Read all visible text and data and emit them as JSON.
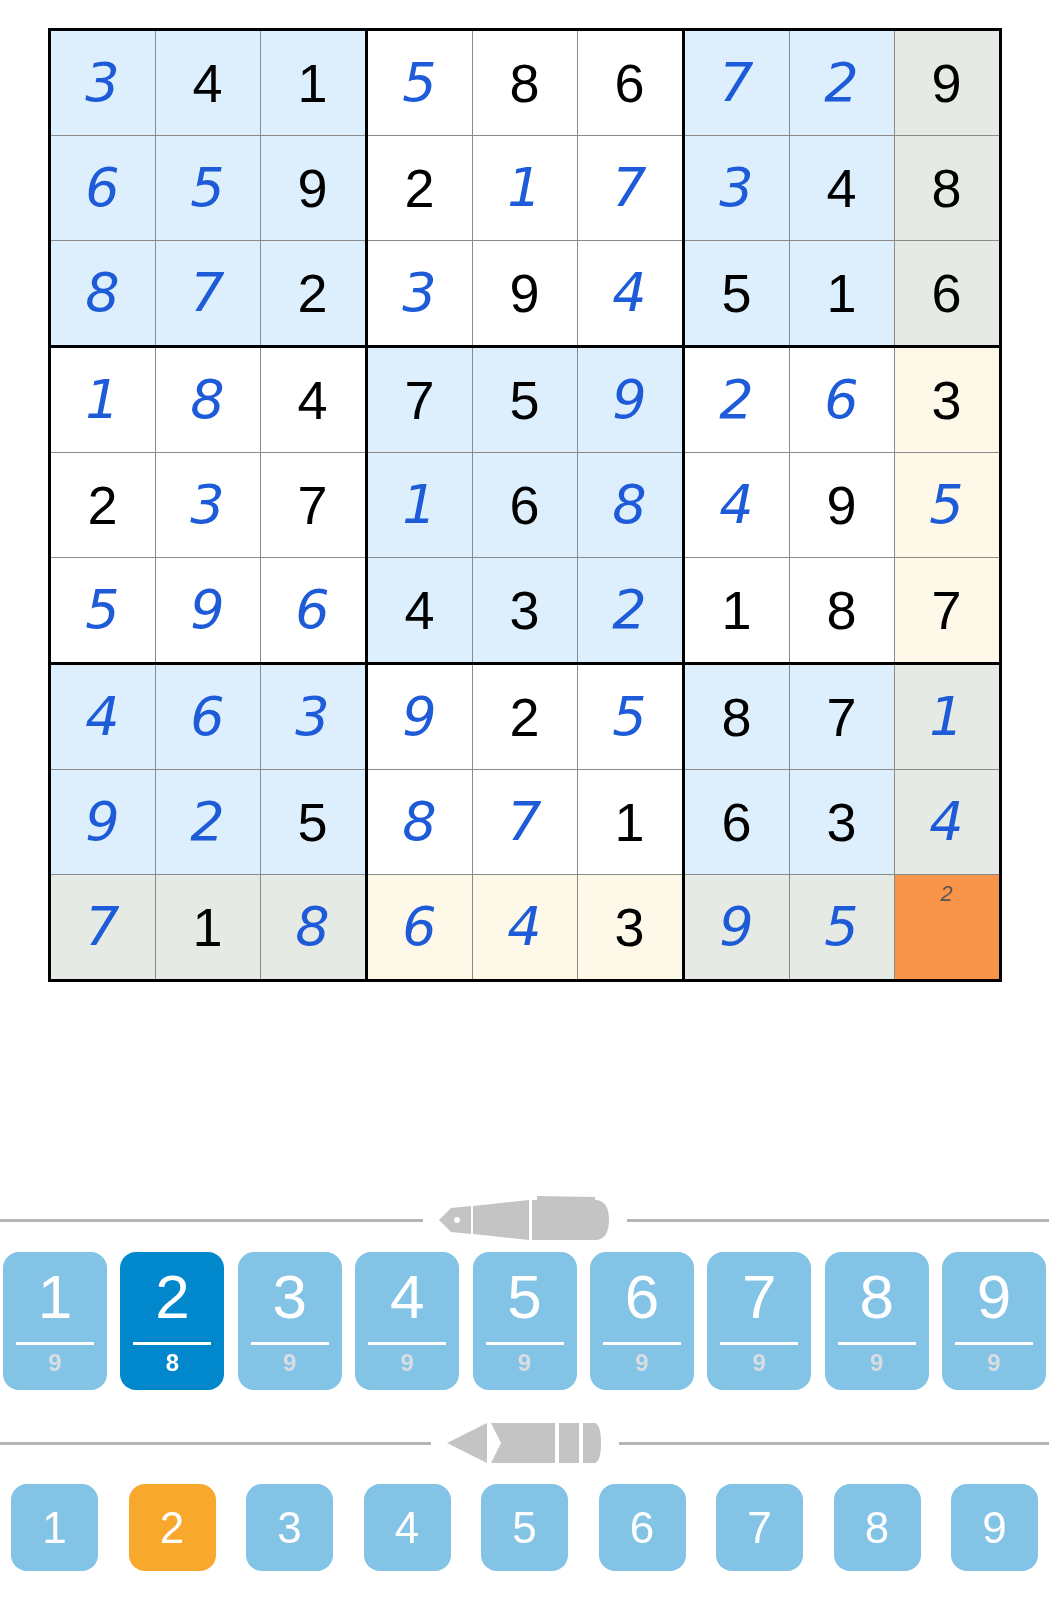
{
  "grid": {
    "rows": [
      [
        {
          "value": "3",
          "kind": "entered",
          "selected": false
        },
        {
          "value": "4",
          "kind": "given",
          "selected": false
        },
        {
          "value": "1",
          "kind": "given",
          "selected": false
        },
        {
          "value": "5",
          "kind": "entered",
          "selected": false
        },
        {
          "value": "8",
          "kind": "given",
          "selected": false
        },
        {
          "value": "6",
          "kind": "given",
          "selected": false
        },
        {
          "value": "7",
          "kind": "entered",
          "selected": false
        },
        {
          "value": "2",
          "kind": "entered",
          "selected": false
        },
        {
          "value": "9",
          "kind": "given",
          "selected": false
        }
      ],
      [
        {
          "value": "6",
          "kind": "entered",
          "selected": false
        },
        {
          "value": "5",
          "kind": "entered",
          "selected": false
        },
        {
          "value": "9",
          "kind": "given",
          "selected": false
        },
        {
          "value": "2",
          "kind": "given",
          "selected": false
        },
        {
          "value": "1",
          "kind": "entered",
          "selected": false
        },
        {
          "value": "7",
          "kind": "entered",
          "selected": false
        },
        {
          "value": "3",
          "kind": "entered",
          "selected": false
        },
        {
          "value": "4",
          "kind": "given",
          "selected": false
        },
        {
          "value": "8",
          "kind": "given",
          "selected": false
        }
      ],
      [
        {
          "value": "8",
          "kind": "entered",
          "selected": false
        },
        {
          "value": "7",
          "kind": "entered",
          "selected": false
        },
        {
          "value": "2",
          "kind": "given",
          "selected": false
        },
        {
          "value": "3",
          "kind": "entered",
          "selected": false
        },
        {
          "value": "9",
          "kind": "given",
          "selected": false
        },
        {
          "value": "4",
          "kind": "entered",
          "selected": false
        },
        {
          "value": "5",
          "kind": "given",
          "selected": false
        },
        {
          "value": "1",
          "kind": "given",
          "selected": false
        },
        {
          "value": "6",
          "kind": "given",
          "selected": false
        }
      ],
      [
        {
          "value": "1",
          "kind": "entered",
          "selected": false
        },
        {
          "value": "8",
          "kind": "entered",
          "selected": false
        },
        {
          "value": "4",
          "kind": "given",
          "selected": false
        },
        {
          "value": "7",
          "kind": "given",
          "selected": false
        },
        {
          "value": "5",
          "kind": "given",
          "selected": false
        },
        {
          "value": "9",
          "kind": "entered",
          "selected": false
        },
        {
          "value": "2",
          "kind": "entered",
          "selected": false
        },
        {
          "value": "6",
          "kind": "entered",
          "selected": false
        },
        {
          "value": "3",
          "kind": "given",
          "selected": false
        }
      ],
      [
        {
          "value": "2",
          "kind": "given",
          "selected": false
        },
        {
          "value": "3",
          "kind": "entered",
          "selected": false
        },
        {
          "value": "7",
          "kind": "given",
          "selected": false
        },
        {
          "value": "1",
          "kind": "entered",
          "selected": false
        },
        {
          "value": "6",
          "kind": "given",
          "selected": false
        },
        {
          "value": "8",
          "kind": "entered",
          "selected": false
        },
        {
          "value": "4",
          "kind": "entered",
          "selected": false
        },
        {
          "value": "9",
          "kind": "given",
          "selected": false
        },
        {
          "value": "5",
          "kind": "entered",
          "selected": false
        }
      ],
      [
        {
          "value": "5",
          "kind": "entered",
          "selected": false
        },
        {
          "value": "9",
          "kind": "entered",
          "selected": false
        },
        {
          "value": "6",
          "kind": "entered",
          "selected": false
        },
        {
          "value": "4",
          "kind": "given",
          "selected": false
        },
        {
          "value": "3",
          "kind": "given",
          "selected": false
        },
        {
          "value": "2",
          "kind": "entered",
          "selected": false
        },
        {
          "value": "1",
          "kind": "given",
          "selected": false
        },
        {
          "value": "8",
          "kind": "given",
          "selected": false
        },
        {
          "value": "7",
          "kind": "given",
          "selected": false
        }
      ],
      [
        {
          "value": "4",
          "kind": "entered",
          "selected": false
        },
        {
          "value": "6",
          "kind": "entered",
          "selected": false
        },
        {
          "value": "3",
          "kind": "entered",
          "selected": false
        },
        {
          "value": "9",
          "kind": "entered",
          "selected": false
        },
        {
          "value": "2",
          "kind": "given",
          "selected": false
        },
        {
          "value": "5",
          "kind": "entered",
          "selected": false
        },
        {
          "value": "8",
          "kind": "given",
          "selected": false
        },
        {
          "value": "7",
          "kind": "given",
          "selected": false
        },
        {
          "value": "1",
          "kind": "entered",
          "selected": false
        }
      ],
      [
        {
          "value": "9",
          "kind": "entered",
          "selected": false
        },
        {
          "value": "2",
          "kind": "entered",
          "selected": false
        },
        {
          "value": "5",
          "kind": "given",
          "selected": false
        },
        {
          "value": "8",
          "kind": "entered",
          "selected": false
        },
        {
          "value": "7",
          "kind": "entered",
          "selected": false
        },
        {
          "value": "1",
          "kind": "given",
          "selected": false
        },
        {
          "value": "6",
          "kind": "given",
          "selected": false
        },
        {
          "value": "3",
          "kind": "given",
          "selected": false
        },
        {
          "value": "4",
          "kind": "entered",
          "selected": false
        }
      ],
      [
        {
          "value": "7",
          "kind": "entered",
          "selected": false
        },
        {
          "value": "1",
          "kind": "given",
          "selected": false
        },
        {
          "value": "8",
          "kind": "entered",
          "selected": false
        },
        {
          "value": "6",
          "kind": "entered",
          "selected": false
        },
        {
          "value": "4",
          "kind": "entered",
          "selected": false
        },
        {
          "value": "3",
          "kind": "given",
          "selected": false
        },
        {
          "value": "9",
          "kind": "entered",
          "selected": false
        },
        {
          "value": "5",
          "kind": "entered",
          "selected": false
        },
        {
          "notes": [
            "2"
          ],
          "kind": "notes",
          "selected": true
        }
      ]
    ]
  },
  "pen_pad": [
    {
      "digit": "1",
      "count": "9",
      "selected": false
    },
    {
      "digit": "2",
      "count": "8",
      "selected": true
    },
    {
      "digit": "3",
      "count": "9",
      "selected": false
    },
    {
      "digit": "4",
      "count": "9",
      "selected": false
    },
    {
      "digit": "5",
      "count": "9",
      "selected": false
    },
    {
      "digit": "6",
      "count": "9",
      "selected": false
    },
    {
      "digit": "7",
      "count": "9",
      "selected": false
    },
    {
      "digit": "8",
      "count": "9",
      "selected": false
    },
    {
      "digit": "9",
      "count": "9",
      "selected": false
    }
  ],
  "pencil_pad": [
    {
      "digit": "1",
      "selected": false
    },
    {
      "digit": "2",
      "selected": true
    },
    {
      "digit": "3",
      "selected": false
    },
    {
      "digit": "4",
      "selected": false
    },
    {
      "digit": "5",
      "selected": false
    },
    {
      "digit": "6",
      "selected": false
    },
    {
      "digit": "7",
      "selected": false
    },
    {
      "digit": "8",
      "selected": false
    },
    {
      "digit": "9",
      "selected": false
    }
  ]
}
